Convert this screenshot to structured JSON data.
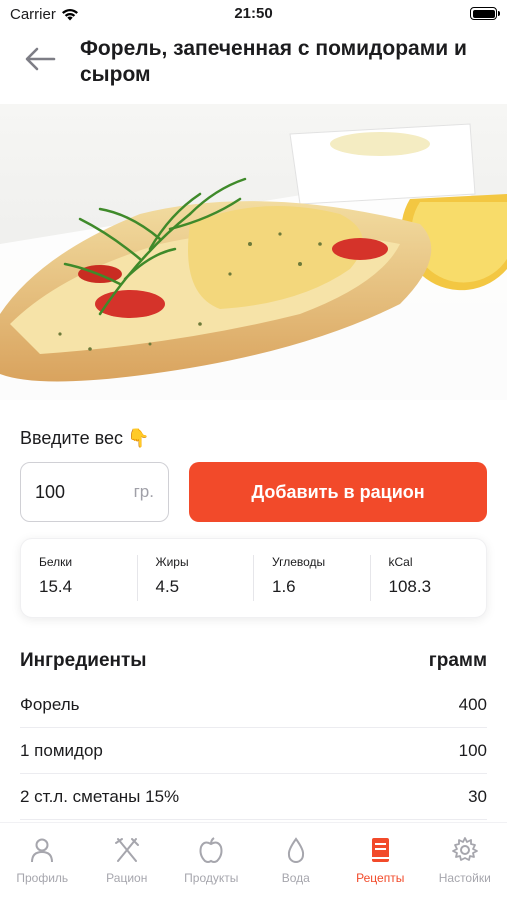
{
  "status_bar": {
    "carrier": "Carrier",
    "time": "21:50"
  },
  "header": {
    "title": "Форель, запеченная с помидорами и сыром"
  },
  "weight": {
    "label": "Введите вес",
    "emoji": "👇",
    "value": "100",
    "unit": "гр.",
    "add_button": "Добавить в рацион"
  },
  "nutrition": [
    {
      "name": "Белки",
      "value": "15.4"
    },
    {
      "name": "Жиры",
      "value": "4.5"
    },
    {
      "name": "Углеводы",
      "value": "1.6"
    },
    {
      "name": "kCal",
      "value": "108.3"
    }
  ],
  "ingredients": {
    "header_name": "Ингредиенты",
    "header_unit": "грамм",
    "items": [
      {
        "name": "Форель",
        "amount": "400"
      },
      {
        "name": "1 помидор",
        "amount": "100"
      },
      {
        "name": "2 ст.л. сметаны 15%",
        "amount": "30"
      }
    ]
  },
  "tabs": [
    {
      "label": "Профиль",
      "icon": "profile-icon",
      "active": false
    },
    {
      "label": "Рацион",
      "icon": "utensils-icon",
      "active": false
    },
    {
      "label": "Продукты",
      "icon": "apple-icon",
      "active": false
    },
    {
      "label": "Вода",
      "icon": "water-drop-icon",
      "active": false
    },
    {
      "label": "Рецепты",
      "icon": "recipe-book-icon",
      "active": true
    },
    {
      "label": "Настойки",
      "icon": "gear-icon",
      "active": false
    }
  ],
  "colors": {
    "accent": "#f24a2a",
    "inactive": "#a6a6ad"
  }
}
